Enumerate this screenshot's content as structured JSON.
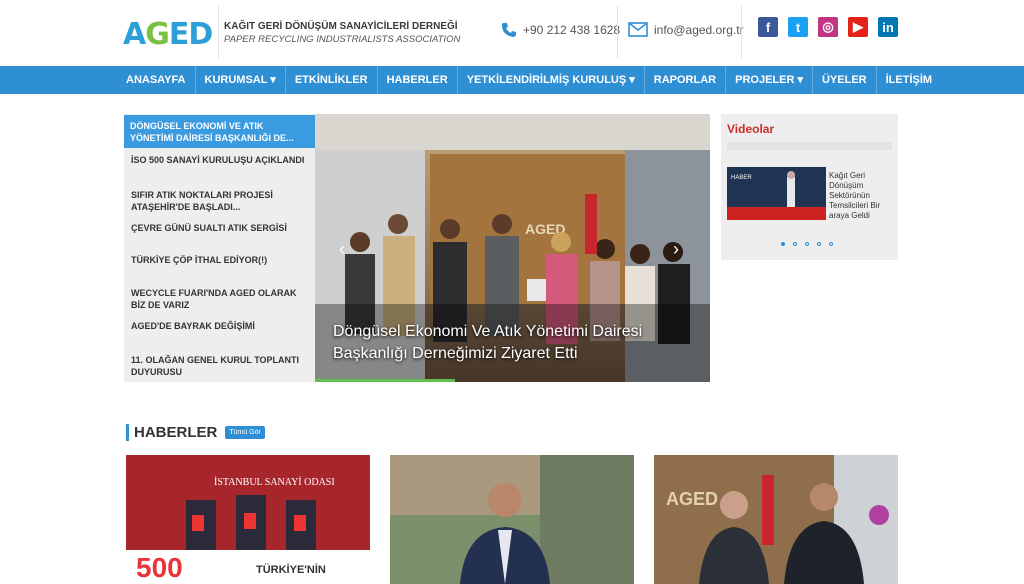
{
  "header": {
    "logo": {
      "a": "A",
      "g": "G",
      "e": "E",
      "d": "D"
    },
    "org_tr": "KAĞIT GERİ DÖNÜŞÜM SANAYİCİLERİ DERNEĞİ",
    "org_en": "PAPER RECYCLING INDUSTRIALISTS ASSOCIATION",
    "phone": "+90 212 438 1628",
    "email": "info@aged.org.tr",
    "social": [
      {
        "name": "facebook-icon",
        "glyph": "f",
        "color": "#3b5998"
      },
      {
        "name": "twitter-icon",
        "glyph": "t",
        "color": "#1da1f2"
      },
      {
        "name": "instagram-icon",
        "glyph": "◎",
        "color": "#c13584"
      },
      {
        "name": "youtube-icon",
        "glyph": "▶",
        "color": "#e62117"
      },
      {
        "name": "linkedin-icon",
        "glyph": "in",
        "color": "#0077b5"
      }
    ]
  },
  "nav": {
    "items": [
      "ANASAYFA",
      "KURUMSAL ▾",
      "ETKİNLİKLER",
      "HABERLER",
      "YETKİLENDİRİLMİŞ KURULUŞ ▾",
      "RAPORLAR",
      "PROJELER ▾",
      "ÜYELER",
      "İLETİŞİM"
    ]
  },
  "side": {
    "active": "DÖNGÜSEL EKONOMİ VE ATIK YÖNETİMİ DAİRESİ BAŞKANLIĞI DE...",
    "items": [
      "İSO 500 SANAYİ KURULUŞU AÇIKLANDI",
      "SIFIR ATIK NOKTALARI PROJESİ ATAŞEHİR'DE BAŞLADI...",
      "ÇEVRE GÜNÜ SUALTI ATIK SERGİSİ",
      "TÜRKİYE ÇÖP İTHAL EDİYOR(!)",
      "WECYCLE FUARI'NDA AGED OLARAK BİZ DE VARIZ",
      "AGED'DE BAYRAK DEĞİŞİMİ",
      "11. OLAĞAN GENEL KURUL TOPLANTI DUYURUSU"
    ]
  },
  "slider": {
    "caption": "Döngüsel Ekonomi Ve Atık Yönetimi Dairesi Başkanlığı Derneğimizi Ziyaret Etti",
    "brand": "AGED",
    "prev": "‹",
    "next": "›"
  },
  "videos": {
    "title": "Videolar",
    "item": "Kağıt Geri Dönüşüm Sektörünün Temsilcileri Bir araya Geldi",
    "thumb_label": "HABER"
  },
  "news": {
    "title": "HABERLER",
    "all": "Tümü Gör",
    "card1_top": "İSTANBUL SANAYİ ODASI",
    "card1_bottom": "TÜRKİYE'NİN",
    "card1_num": "500",
    "card3_brand": "AGED"
  }
}
